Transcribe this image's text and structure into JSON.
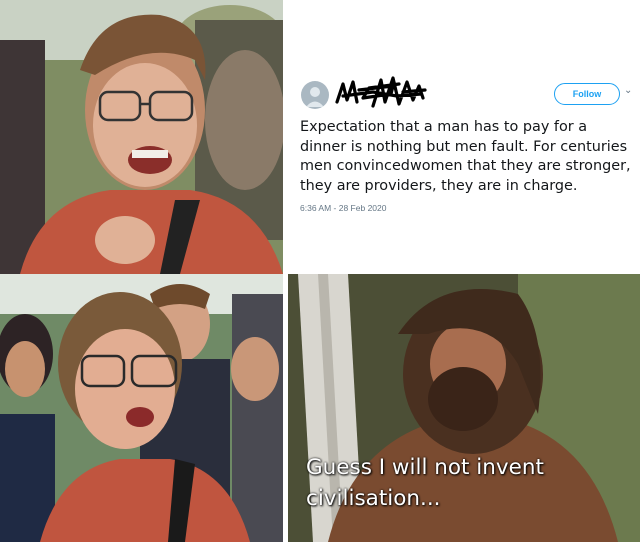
{
  "tweet": {
    "follow_label": "Follow",
    "text": "Expectation that a man has to pay for a dinner is nothing but men fault. For centuries men convincedwomen that they are stronger, they are providers, they are in charge.",
    "timestamp": "6:36 AM - 28 Feb 2020",
    "avatar_icon": "default-avatar-icon",
    "follow_color": "#1da1f2"
  },
  "caption": {
    "text": "Guess I will not invent civilisation..."
  }
}
